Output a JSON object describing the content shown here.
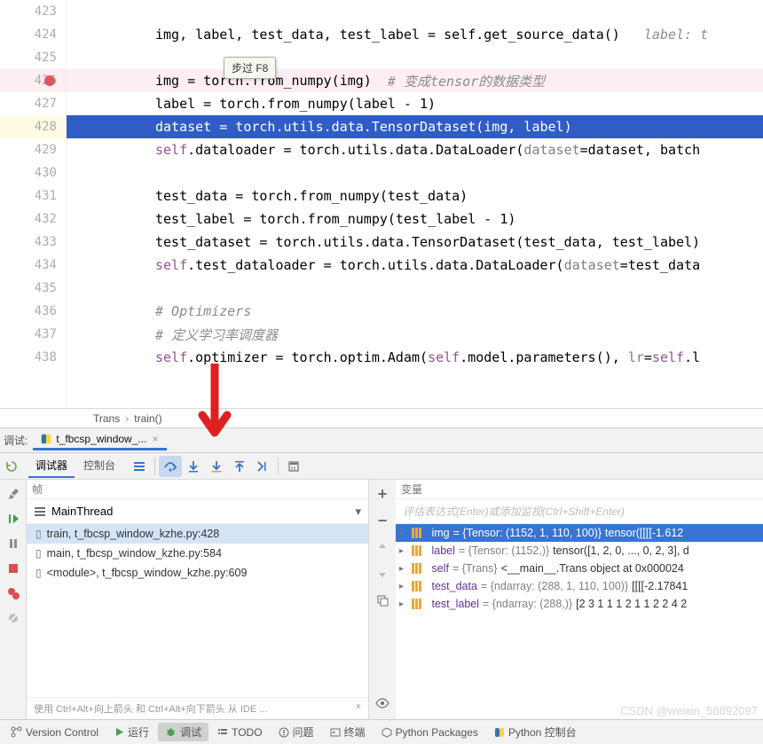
{
  "gutter": [
    "423",
    "424",
    "425",
    "426",
    "427",
    "428",
    "429",
    "430",
    "431",
    "432",
    "433",
    "434",
    "435",
    "436",
    "437",
    "438",
    ""
  ],
  "breakpoint_line_index": 3,
  "current_line_index": 5,
  "code": {
    "l424": {
      "text": "img, label, test_data, test_label = self.get_source_data()",
      "comment": "   label: t"
    },
    "l426": {
      "text": "img = torch.from_numpy(img)",
      "comment": "  # 变成tensor的数据类型"
    },
    "l427": "label = torch.from_numpy(label - 1)",
    "l428": "dataset = torch.utils.data.TensorDataset(img, label)",
    "l429": {
      "pre": "self",
      "rest": ".dataloader = torch.utils.data.DataLoader(",
      "p": "dataset",
      "rest2": "=dataset, batch"
    },
    "l431": "test_data = torch.from_numpy(test_data)",
    "l432": "test_label = torch.from_numpy(test_label - 1)",
    "l433": "test_dataset = torch.utils.data.TensorDataset(test_data, test_label)",
    "l434": {
      "pre": "self",
      "rest": ".test_dataloader = torch.utils.data.DataLoader(",
      "p": "dataset",
      "rest2": "=test_data"
    },
    "l436": "# Optimizers",
    "l437": "# 定义学习率调度器",
    "l438": {
      "pre": "self",
      "mid": ".optimizer = torch.optim.Adam(",
      "pre2": "self",
      "mid2": ".model.parameters(), ",
      "p": "lr",
      "rest": "=",
      "pre3": "self",
      "end": ".l"
    }
  },
  "breadcrumb": {
    "a": "Trans",
    "b": "train()"
  },
  "debug": {
    "label": "调试:",
    "tab": "t_fbcsp_window_...",
    "sub_debugger": "调试器",
    "sub_console": "控制台",
    "tooltip": "步过 F8",
    "frames_header": "帧",
    "vars_header": "变量",
    "thread": "MainThread",
    "frames": [
      "train, t_fbcsp_window_kzhe.py:428",
      "main, t_fbcsp_window_kzhe.py:584",
      "<module>, t_fbcsp_window_kzhe.py:609"
    ],
    "frames_footer": "使用 Ctrl+Alt+向上箭头 和 Ctrl+Alt+向下箭头 从 IDE ...",
    "vars_placeholder": "评估表达式(Enter)或添加监视(Ctrl+Shift+Enter)",
    "vars": [
      {
        "n": "img",
        "t": " = {Tensor: (1152, 1, 110, 100)}",
        "v": " tensor([[[[-1.612"
      },
      {
        "n": "label",
        "t": " = {Tensor: (1152,)}",
        "v": " tensor([1, 2, 0,  ..., 0, 2, 3], d"
      },
      {
        "n": "self",
        "t": " = {Trans}",
        "v": " <__main__.Trans object at 0x000024"
      },
      {
        "n": "test_data",
        "t": " = {ndarray: (288, 1, 110, 100)}",
        "v": " [[[[-2.17841"
      },
      {
        "n": "test_label",
        "t": " = {ndarray: (288,)}",
        "v": " [2 3 1 1 1 2 1 1 2 2 4 2"
      }
    ]
  },
  "status": {
    "vc": "Version Control",
    "run": "运行",
    "debug": "调试",
    "todo": "TODO",
    "problems": "问题",
    "terminal": "终端",
    "pypkg": "Python Packages",
    "pyconsole": "Python 控制台"
  },
  "watermark": "CSDN @weixin_58892097"
}
